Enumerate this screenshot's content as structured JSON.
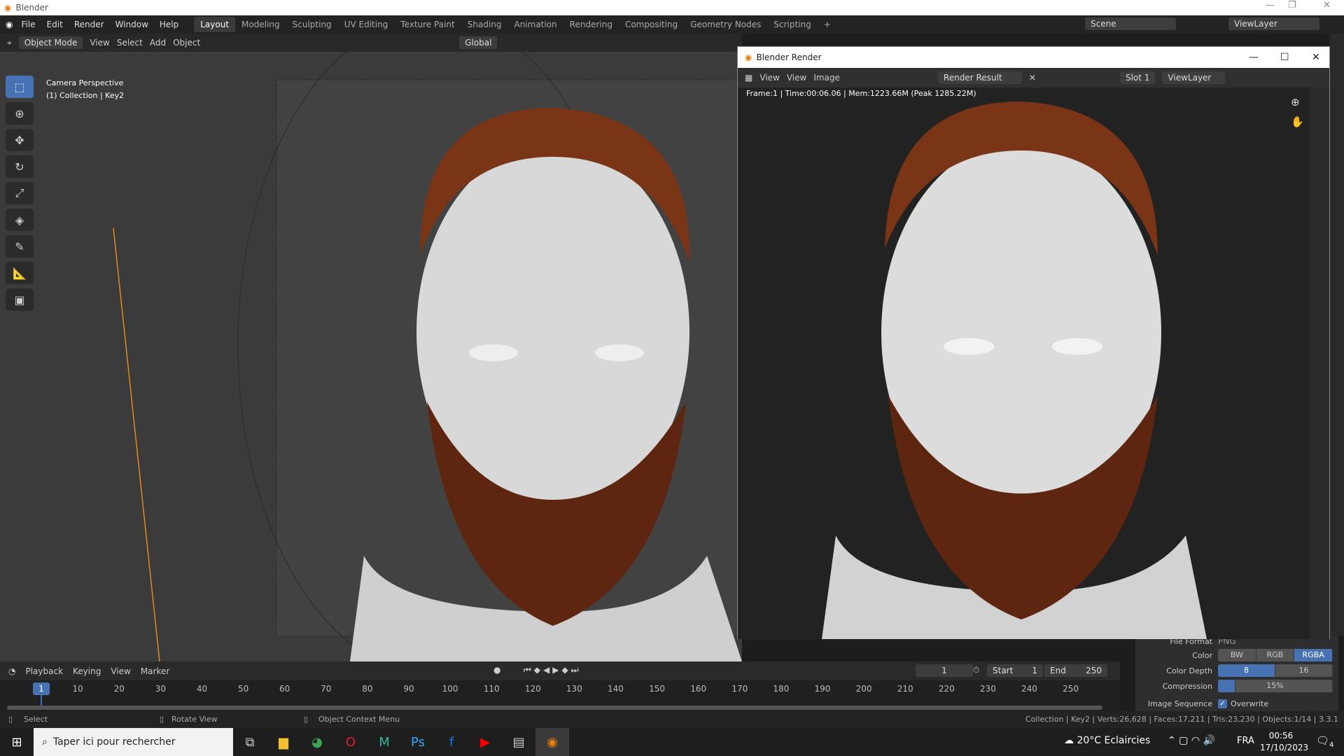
{
  "window": {
    "title": "Blender"
  },
  "menu": [
    "File",
    "Edit",
    "Render",
    "Window",
    "Help"
  ],
  "workspaces": [
    "Layout",
    "Modeling",
    "Sculpting",
    "UV Editing",
    "Texture Paint",
    "Shading",
    "Animation",
    "Rendering",
    "Compositing",
    "Geometry Nodes",
    "Scripting",
    "+"
  ],
  "scene": {
    "name": "Scene",
    "view_layer": "ViewLayer"
  },
  "header": {
    "mode": "Object Mode",
    "items": [
      "View",
      "Select",
      "Add",
      "Object"
    ],
    "orientation": "Global"
  },
  "viewport": {
    "camera": "Camera Perspective",
    "collection": "(1) Collection | Key2"
  },
  "render_window": {
    "title": "Blender Render",
    "menu": [
      "View",
      "View",
      "Image"
    ],
    "image": "Render Result",
    "slot": "Slot 1",
    "view_layer": "ViewLayer",
    "info": "Frame:1 | Time:00:06.06 | Mem:1223.66M (Peak 1285.22M)"
  },
  "props": {
    "file_format_label": "File Format",
    "file_format": "PNG",
    "color_label": "Color",
    "color_options": [
      "BW",
      "RGB",
      "RGBA"
    ],
    "depth_label": "Color Depth",
    "depth_options": [
      "8",
      "16"
    ],
    "compression_label": "Compression",
    "compression": "15%",
    "compression_value": 0.15,
    "seq_label": "Image Sequence",
    "overwrite": "Overwrite"
  },
  "timeline": {
    "menu": [
      "Playback",
      "Keying",
      "View",
      "Marker"
    ],
    "current_frame": "1",
    "start_label": "Start",
    "start": "1",
    "end_label": "End",
    "end": "250",
    "ticks": [
      "10",
      "20",
      "30",
      "40",
      "50",
      "60",
      "70",
      "80",
      "90",
      "100",
      "110",
      "120",
      "130",
      "140",
      "150",
      "160",
      "170",
      "180",
      "190",
      "200",
      "210",
      "220",
      "230",
      "240",
      "250"
    ]
  },
  "status": {
    "select": "Select",
    "rotate": "Rotate View",
    "context": "Object Context Menu",
    "stats": "Collection | Key2 | Verts:26,628 | Faces:17,211 | Tris:23,230 | Objects:1/14 | 3.3.1"
  },
  "taskbar": {
    "search": "Taper ici pour rechercher",
    "weather": "20°C  Eclaircies",
    "lang": "FRA",
    "time": "00:56",
    "date": "17/10/2023",
    "notifications": "4"
  }
}
